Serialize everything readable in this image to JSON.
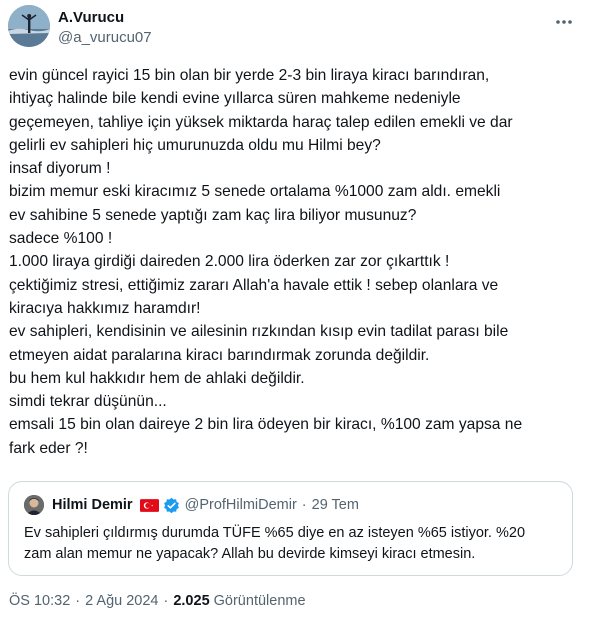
{
  "author": {
    "display_name": "A.Vurucu",
    "handle": "@a_vurucu07"
  },
  "tweet_lines": [
    "evin güncel rayici 15 bin olan bir yerde 2-3 bin liraya kiracı barındıran,",
    "ihtiyaç halinde bile kendi evine yıllarca süren mahkeme nedeniyle",
    "geçemeyen, tahliye için yüksek miktarda haraç talep edilen emekli ve dar",
    "gelirli ev sahipleri hiç umurunuzda oldu mu Hilmi bey?",
    "insaf diyorum !",
    "bizim memur eski kiracımız 5 senede ortalama %1000 zam aldı. emekli",
    "ev sahibine 5 senede yaptığı zam kaç lira biliyor musunuz?",
    "sadece %100 !",
    "1.000 liraya girdiği daireden 2.000 lira öderken zar zor çıkarttık !",
    "çektiğimiz stresi, ettiğimiz zararı Allah'a havale ettik ! sebep olanlara ve",
    "kiracıya hakkımız haramdır!",
    "ev sahipleri, kendisinin ve ailesinin rızkından kısıp evin tadilat parası bile",
    "etmeyen aidat paralarına kiracı barındırmak zorunda değildir.",
    "bu hem kul hakkıdır hem de ahlaki değildir.",
    "simdi tekrar düşünün...",
    "emsali 15 bin olan daireye 2 bin lira ödeyen bir kiracı, %100 zam yapsa ne",
    "fark eder ?!"
  ],
  "quote": {
    "display_name": "Hilmi Demir",
    "handle": "@ProfHilmiDemir",
    "separator": "·",
    "time": "29 Tem",
    "text_lines": [
      "Ev sahipleri çıldırmış durumda TÜFE %65 diye en az isteyen %65 istiyor. %20",
      "zam alan memur ne yapacak? Allah bu devirde kimseyi kiracı etmesin."
    ]
  },
  "meta": {
    "time": "ÖS 10:32",
    "separator": "·",
    "date": "2 Ağu 2024",
    "views_count": "2.025",
    "views_label": "Görüntülenme"
  },
  "icons": {
    "more": "more-horizontal-icon",
    "verified": "verified-badge-icon",
    "flag": "turkey-flag-icon"
  },
  "colors": {
    "text": "#0f1419",
    "secondary": "#536471",
    "border": "#cfd9de",
    "verified": "#1d9bf0",
    "flag": "#e30a17"
  }
}
